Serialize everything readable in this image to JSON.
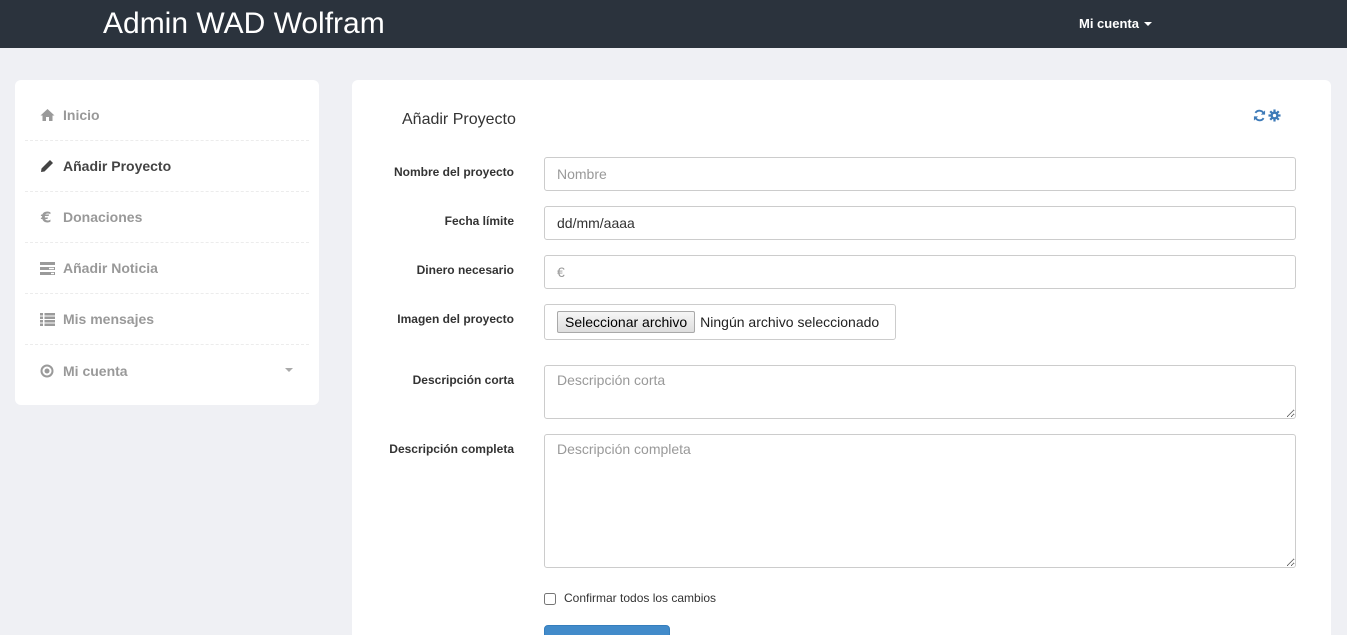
{
  "app": {
    "title": "Admin WAD Wolfram",
    "account_menu_label": "Mi cuenta"
  },
  "sidebar": {
    "items": [
      {
        "label": "Inicio",
        "icon": "home-icon",
        "active": false
      },
      {
        "label": "Añadir Proyecto",
        "icon": "pencil-icon",
        "active": true
      },
      {
        "label": "Donaciones",
        "icon": "euro-icon",
        "active": false
      },
      {
        "label": "Añadir Noticia",
        "icon": "tasks-icon",
        "active": false
      },
      {
        "label": "Mis mensajes",
        "icon": "list-icon",
        "active": false
      },
      {
        "label": "Mi cuenta",
        "icon": "record-icon",
        "active": false
      }
    ]
  },
  "panel": {
    "title": "Añadir Proyecto",
    "tools": [
      "refresh-icon",
      "cog-icon"
    ]
  },
  "form": {
    "name_label": "Nombre del proyecto",
    "name_placeholder": "Nombre",
    "deadline_label": "Fecha límite",
    "deadline_placeholder": "dd/mm/aaaa",
    "money_label": "Dinero necesario",
    "money_placeholder": "€",
    "image_label": "Imagen del proyecto",
    "file_button_label": "Seleccionar archivo",
    "file_status": "Ningún archivo seleccionado",
    "short_desc_label": "Descripción corta",
    "short_desc_placeholder": "Descripción corta",
    "full_desc_label": "Descripción completa",
    "full_desc_placeholder": "Descripción completa",
    "confirm_label": "Confirmar todos los cambios",
    "confirm_checked": false
  },
  "colors": {
    "topbar": "#2b333d",
    "page_background": "#eff0f4",
    "accent": "#428bca",
    "tool_icon": "#3d7ab8"
  }
}
